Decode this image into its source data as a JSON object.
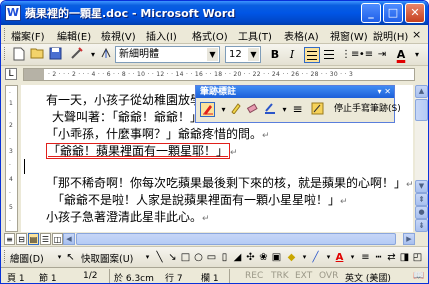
{
  "window": {
    "title": "蘋果裡的一顆星.doc - Microsoft Word",
    "min_label": "_",
    "max_label": "□",
    "close_label": "✕"
  },
  "menu": {
    "items": [
      "檔案(F)",
      "編輯(E)",
      "檢視(V)",
      "插入(I)",
      "格式(O)",
      "工具(T)",
      "表格(A)",
      "視窗(W)",
      "說明(H)"
    ],
    "close": "×"
  },
  "toolbar": {
    "font_name": "新細明體",
    "font_size": "12",
    "bold_label": "B",
    "italic_label": "I"
  },
  "ruler": {
    "ticks": "· 2 · · · 2 · · · 4 · · 6 · · 8 · · 10 · · 12 · · 14 · · 16 · · 18 · · 20 · · 22 · · 24 · · 26 · · 28 · · 30 · · 3"
  },
  "document": {
    "lines": [
      "有一天，小孩子從幼稚園放學",
      "大聲叫著：「爺爺！爺爺！」",
      "「小乖孫，什麼事啊？」爺爺疼惜的問。",
      "「爺爺！蘋果裡面有一顆星耶！」",
      "「那不稀奇啊！你每次吃蘋果最後剩下來的核，就是蘋果的心啊！」",
      "「爺爺不是啦！人家是說蘋果裡面有一顆小星星啦！」",
      "小孩子急著澄清此星非此心。"
    ],
    "para_mark": "↵"
  },
  "ink_toolbar": {
    "title": "筆跡標註",
    "stop_label": "停止手寫筆跡(S)"
  },
  "drawing_toolbar": {
    "draw_label": "繪圖(D)",
    "autoshapes_label": "快取圖案(U)"
  },
  "status": {
    "page": "頁 1",
    "section": "節 1",
    "page_of": "1/2",
    "at": "於 6.3cm",
    "line": "行 7",
    "col": "欄 1",
    "rec": "REC",
    "trk": "TRK",
    "ext": "EXT",
    "ovr": "OVR",
    "lang": "英文 (美國)"
  }
}
